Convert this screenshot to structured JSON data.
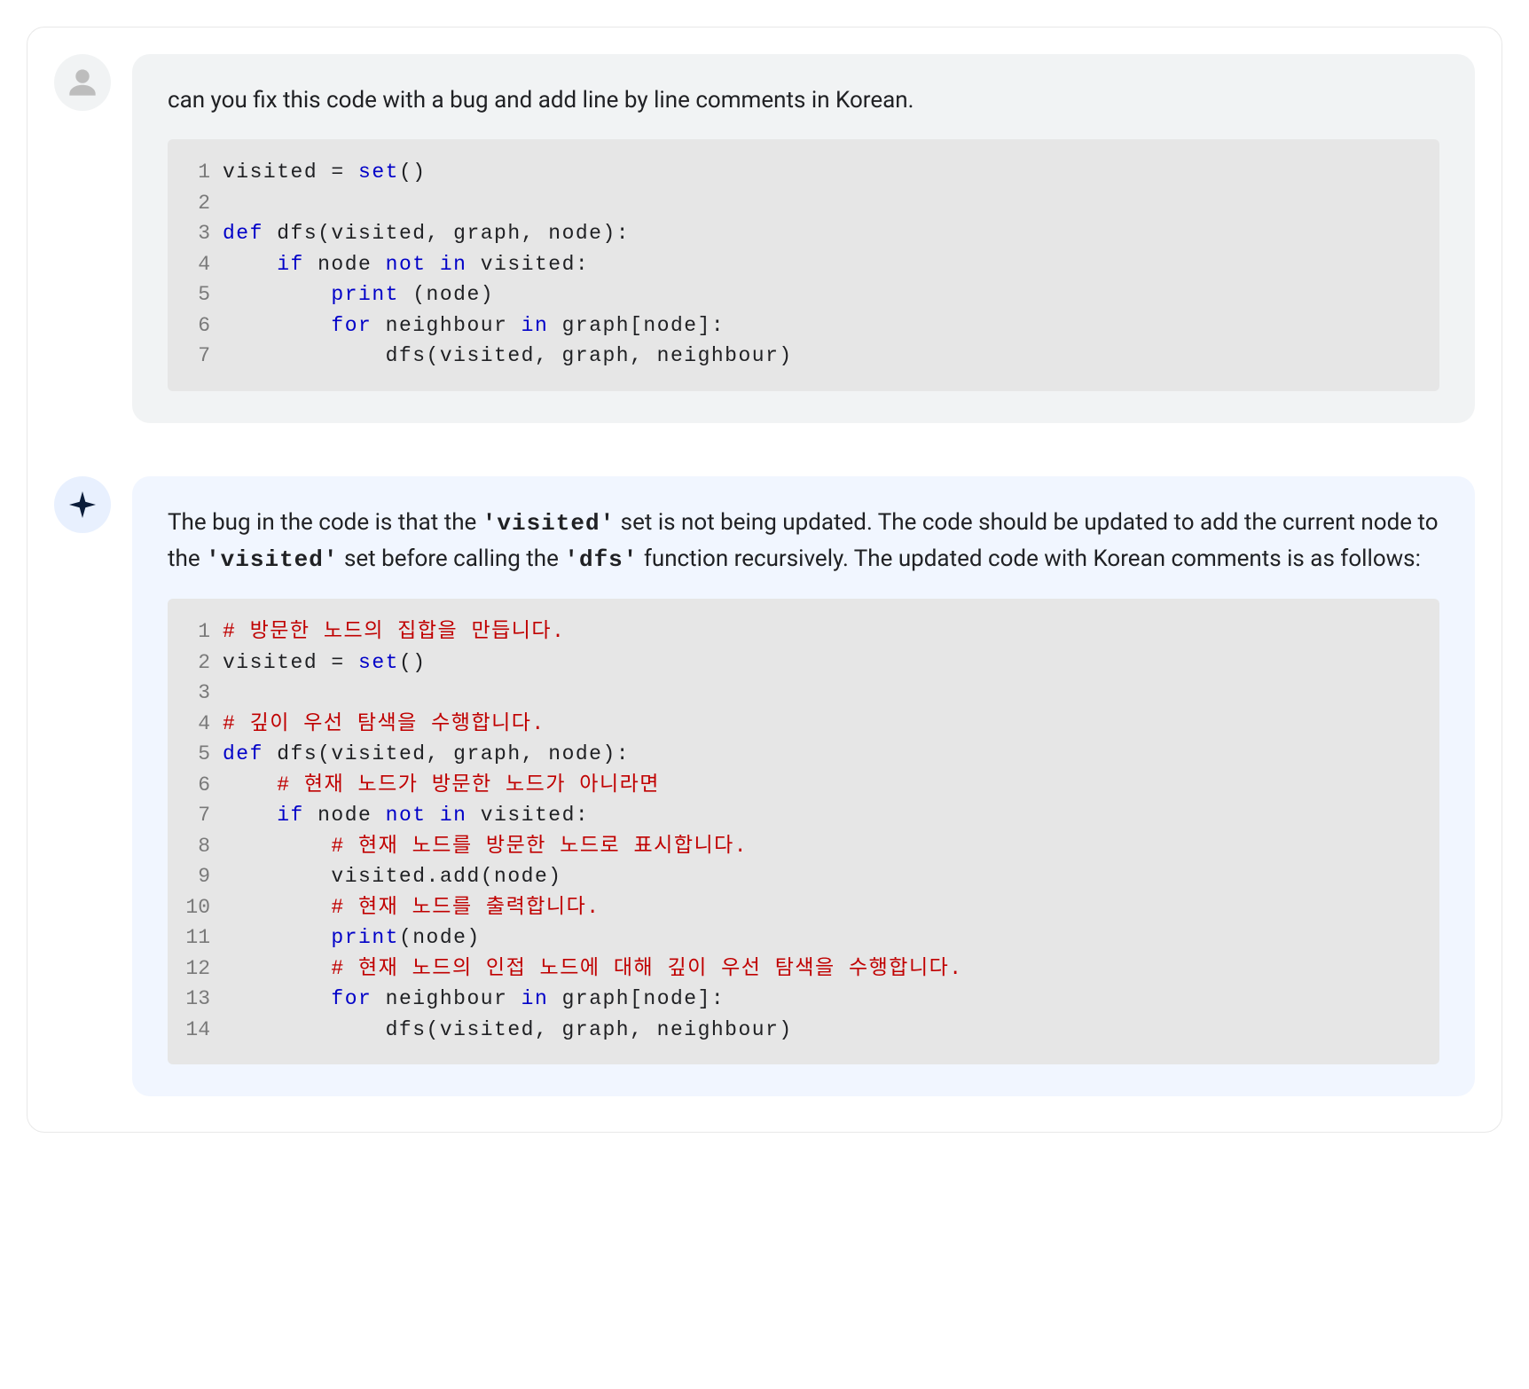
{
  "user": {
    "prompt": "can you fix this code with a bug and add line by line comments in Korean.",
    "code": [
      {
        "n": 1,
        "tokens": [
          [
            "",
            "visited = "
          ],
          [
            "fn",
            "set"
          ],
          [
            "",
            "()"
          ]
        ]
      },
      {
        "n": 2,
        "tokens": [
          [
            "",
            ""
          ]
        ]
      },
      {
        "n": 3,
        "tokens": [
          [
            "kw",
            "def"
          ],
          [
            "",
            " dfs(visited, graph, node):"
          ]
        ]
      },
      {
        "n": 4,
        "tokens": [
          [
            "",
            "    "
          ],
          [
            "kw",
            "if"
          ],
          [
            "",
            " node "
          ],
          [
            "kw",
            "not in"
          ],
          [
            "",
            " visited:"
          ]
        ]
      },
      {
        "n": 5,
        "tokens": [
          [
            "",
            "        "
          ],
          [
            "fn",
            "print"
          ],
          [
            "",
            " (node)"
          ]
        ]
      },
      {
        "n": 6,
        "tokens": [
          [
            "",
            "        "
          ],
          [
            "kw",
            "for"
          ],
          [
            "",
            " neighbour "
          ],
          [
            "kw",
            "in"
          ],
          [
            "",
            " graph[node]:"
          ]
        ]
      },
      {
        "n": 7,
        "tokens": [
          [
            "",
            "            dfs(visited, graph, neighbour)"
          ]
        ]
      }
    ]
  },
  "assistant": {
    "paragraph": [
      [
        "text",
        "The bug in the code is that the "
      ],
      [
        "code",
        "'visited'"
      ],
      [
        "text",
        " set is not being updated. The code should be updated to add the current node to the "
      ],
      [
        "code",
        "'visited'"
      ],
      [
        "text",
        " set before calling the "
      ],
      [
        "code",
        "'dfs'"
      ],
      [
        "text",
        " function recursively. The updated code with Korean comments is as follows:"
      ]
    ],
    "code": [
      {
        "n": 1,
        "tokens": [
          [
            "cmt",
            "# 방문한 노드의 집합을 만듭니다."
          ]
        ]
      },
      {
        "n": 2,
        "tokens": [
          [
            "",
            "visited = "
          ],
          [
            "fn",
            "set"
          ],
          [
            "",
            "()"
          ]
        ]
      },
      {
        "n": 3,
        "tokens": [
          [
            "",
            ""
          ]
        ]
      },
      {
        "n": 4,
        "tokens": [
          [
            "cmt",
            "# 깊이 우선 탐색을 수행합니다."
          ]
        ]
      },
      {
        "n": 5,
        "tokens": [
          [
            "kw",
            "def"
          ],
          [
            "",
            " dfs(visited, graph, node):"
          ]
        ]
      },
      {
        "n": 6,
        "tokens": [
          [
            "",
            "    "
          ],
          [
            "cmt",
            "# 현재 노드가 방문한 노드가 아니라면"
          ]
        ]
      },
      {
        "n": 7,
        "tokens": [
          [
            "",
            "    "
          ],
          [
            "kw",
            "if"
          ],
          [
            "",
            " node "
          ],
          [
            "kw",
            "not in"
          ],
          [
            "",
            " visited:"
          ]
        ]
      },
      {
        "n": 8,
        "tokens": [
          [
            "",
            "        "
          ],
          [
            "cmt",
            "# 현재 노드를 방문한 노드로 표시합니다."
          ]
        ]
      },
      {
        "n": 9,
        "tokens": [
          [
            "",
            "        visited.add(node)"
          ]
        ]
      },
      {
        "n": 10,
        "tokens": [
          [
            "",
            "        "
          ],
          [
            "cmt",
            "# 현재 노드를 출력합니다."
          ]
        ]
      },
      {
        "n": 11,
        "tokens": [
          [
            "",
            "        "
          ],
          [
            "fn",
            "print"
          ],
          [
            "",
            "(node)"
          ]
        ]
      },
      {
        "n": 12,
        "tokens": [
          [
            "",
            "        "
          ],
          [
            "cmt",
            "# 현재 노드의 인접 노드에 대해 깊이 우선 탐색을 수행합니다."
          ]
        ]
      },
      {
        "n": 13,
        "tokens": [
          [
            "",
            "        "
          ],
          [
            "kw",
            "for"
          ],
          [
            "",
            " neighbour "
          ],
          [
            "kw",
            "in"
          ],
          [
            "",
            " graph[node]:"
          ]
        ]
      },
      {
        "n": 14,
        "tokens": [
          [
            "",
            "            dfs(visited, graph, neighbour)"
          ]
        ]
      }
    ]
  }
}
